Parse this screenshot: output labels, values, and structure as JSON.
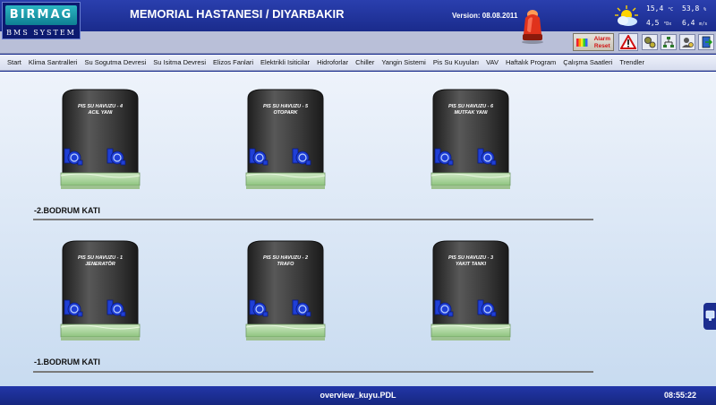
{
  "logo": {
    "name": "BIRMAG",
    "subtitle": "BMS SYSTEM"
  },
  "header": {
    "title": "MEMORIAL HASTANESI / DIYARBAKIR",
    "version": "Version: 08.08.2011"
  },
  "weather": {
    "temperature": "15,4",
    "temperature_unit": "°C",
    "humidity": "53,8",
    "humidity_unit": "%",
    "third": "4,5",
    "third_unit": "°Dx",
    "wind": "6,4",
    "wind_unit": "m/s"
  },
  "toolbar": {
    "alarm_reset_line1": "Alarm",
    "alarm_reset_line2": "Reset"
  },
  "menu": [
    "Start",
    "Klima Santralleri",
    "Su Sogutma Devresi",
    "Su Isitma Devresi",
    "Elizos Fanlari",
    "Elektrikli Isiticilar",
    "Hidroforlar",
    "Chiller",
    "Yangin Sistemi",
    "Pis Su Kuyuları",
    "VAV",
    "Haftalık Program",
    "Çalışma Saatleri",
    "Trendler"
  ],
  "sections": [
    {
      "label": "-2.BODRUM KATI",
      "tanks": [
        {
          "line1": "PIS SU HAVUZU - 4",
          "line2": "ACIL YANI"
        },
        {
          "line1": "PIS SU HAVUZU - 5",
          "line2": "OTOPARK"
        },
        {
          "line1": "PIS SU HAVUZU - 6",
          "line2": "MUTFAK YANI"
        }
      ]
    },
    {
      "label": "-1.BODRUM KATI",
      "tanks": [
        {
          "line1": "PIS SU HAVUZU - 1",
          "line2": "JENERATÖR"
        },
        {
          "line1": "PIS SU HAVUZU - 2",
          "line2": "TRAFO"
        },
        {
          "line1": "PIS SU HAVUZU - 3",
          "line2": "YAKIT TANKI"
        }
      ]
    }
  ],
  "status": {
    "file": "overview_kuyu.PDL",
    "time": "08:55:22"
  },
  "colors": {
    "frame": "#1b2d8f",
    "tank_body": "#3a3a3a",
    "pump": "#1f3fd6",
    "water": "#a6d39a",
    "alarm": "#e0321c"
  }
}
